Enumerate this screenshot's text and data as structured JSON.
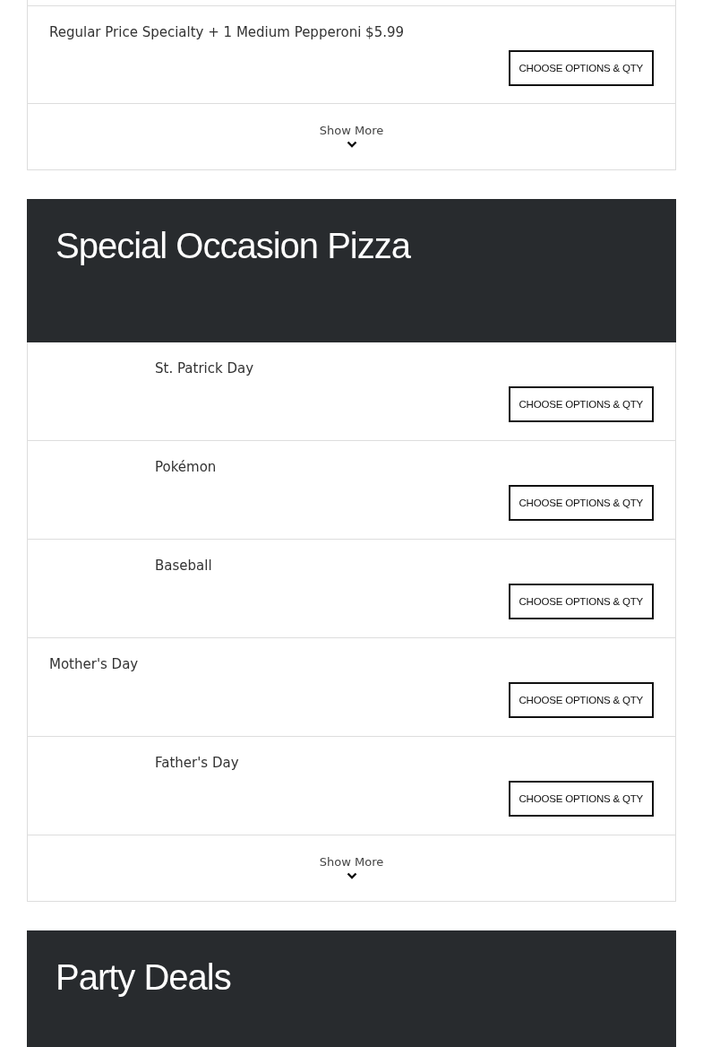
{
  "sections": [
    {
      "items": [
        {
          "name": "Regular Price Specialty + 1 Medium Pepperoni $5.99",
          "kind": "text-only",
          "button": "CHOOSE OPTIONS & QTY"
        }
      ],
      "show_more": "Show More"
    },
    {
      "title": "Special Occasion Pizza",
      "items": [
        {
          "name": "St. Patrick Day",
          "kind": "with-image",
          "button": "CHOOSE OPTIONS & QTY"
        },
        {
          "name": "Pokémon",
          "kind": "with-image",
          "button": "CHOOSE OPTIONS & QTY"
        },
        {
          "name": "Baseball",
          "kind": "with-image",
          "button": "CHOOSE OPTIONS & QTY"
        },
        {
          "name": "Mother's Day",
          "kind": "text-only",
          "button": "CHOOSE OPTIONS & QTY"
        },
        {
          "name": "Father's Day",
          "kind": "with-image",
          "button": "CHOOSE OPTIONS & QTY"
        }
      ],
      "show_more": "Show More"
    },
    {
      "title": "Party Deals"
    }
  ]
}
